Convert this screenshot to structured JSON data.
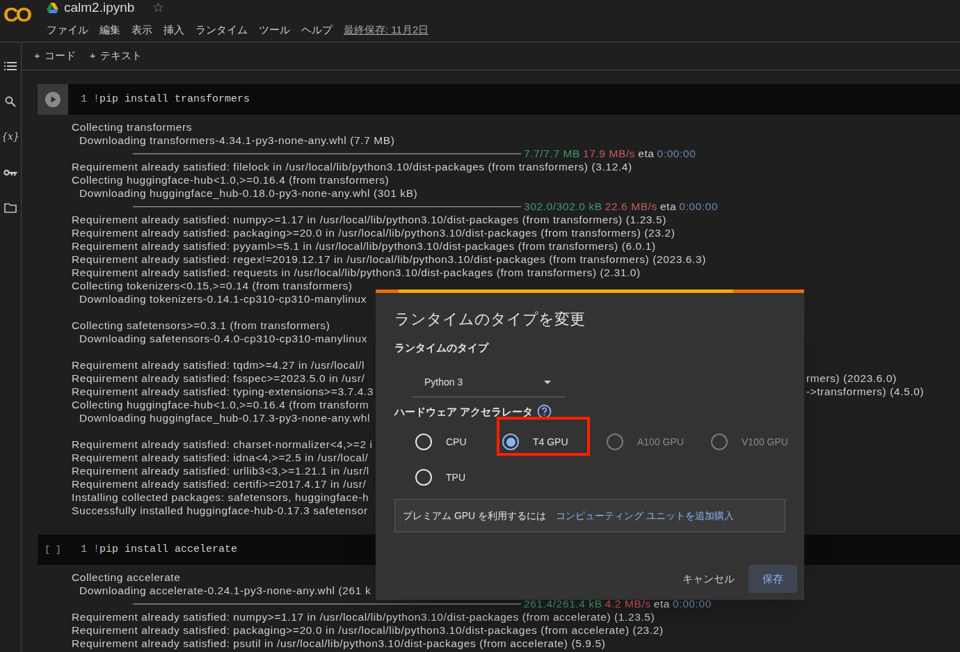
{
  "header": {
    "logo": "CO",
    "title": "calm2.ipynb",
    "star": "☆",
    "starred": false,
    "menu": [
      {
        "label": "ファイル"
      },
      {
        "label": "編集"
      },
      {
        "label": "表示"
      },
      {
        "label": "挿入"
      },
      {
        "label": "ランタイム"
      },
      {
        "label": "ツール"
      },
      {
        "label": "ヘルプ"
      }
    ],
    "last_saved": "最終保存: 11月2日"
  },
  "toolbar": [
    {
      "plus": "+",
      "label": "コード"
    },
    {
      "plus": "+",
      "label": "テキスト"
    }
  ],
  "sidebar": [
    {
      "kind": "toc"
    },
    {
      "kind": "search"
    },
    {
      "kind": "variables",
      "label": "{x}"
    },
    {
      "kind": "key"
    },
    {
      "kind": "folder"
    }
  ],
  "cells": [
    {
      "kind": "ran",
      "line_number": "1",
      "bang": "!",
      "code": "pip install transformers",
      "output": [
        {
          "kind": "text",
          "text": "Collecting transformers"
        },
        {
          "kind": "text",
          "indent": true,
          "text": "Downloading transformers-4.34.1-py3-none-any.whl (7.7 MB)"
        },
        {
          "kind": "progress",
          "level": 1,
          "done": "7.7/7.7 MB",
          "speed": "17.9 MB/s",
          "eta": "eta",
          "time": "0:00:00"
        },
        {
          "kind": "text",
          "text": "Requirement already satisfied: filelock in /usr/local/lib/python3.10/dist-packages (from transformers) (3.12.4)"
        },
        {
          "kind": "text",
          "text": "Collecting huggingface-hub<1.0,>=0.16.4 (from transformers)"
        },
        {
          "kind": "text",
          "indent": true,
          "text": "Downloading huggingface_hub-0.18.0-py3-none-any.whl (301 kB)"
        },
        {
          "kind": "progress",
          "level": 1,
          "done": "302.0/302.0 kB",
          "speed": "22.6 MB/s",
          "eta": "eta",
          "time": "0:00:00"
        },
        {
          "kind": "text",
          "text": "Requirement already satisfied: numpy>=1.17 in /usr/local/lib/python3.10/dist-packages (from transformers) (1.23.5)"
        },
        {
          "kind": "text",
          "text": "Requirement already satisfied: packaging>=20.0 in /usr/local/lib/python3.10/dist-packages (from transformers) (23.2)"
        },
        {
          "kind": "text",
          "text": "Requirement already satisfied: pyyaml>=5.1 in /usr/local/lib/python3.10/dist-packages (from transformers) (6.0.1)"
        },
        {
          "kind": "text",
          "text": "Requirement already satisfied: regex!=2019.12.17 in /usr/local/lib/python3.10/dist-packages (from transformers) (2023.6.3)"
        },
        {
          "kind": "text",
          "text": "Requirement already satisfied: requests in /usr/local/lib/python3.10/dist-packages (from transformers) (2.31.0)"
        },
        {
          "kind": "text",
          "text": "Collecting tokenizers<0.15,>=0.14 (from transformers)"
        },
        {
          "kind": "text",
          "indent": true,
          "text": "Downloading tokenizers-0.14.1-cp310-cp310-manylinux"
        },
        {
          "kind": "blank"
        },
        {
          "kind": "text",
          "text": "Collecting safetensors>=0.3.1 (from transformers)"
        },
        {
          "kind": "text",
          "indent": true,
          "text": "Downloading safetensors-0.4.0-cp310-cp310-manylinux"
        },
        {
          "kind": "blank"
        },
        {
          "kind": "text",
          "text": "Requirement already satisfied: tqdm>=4.27 in /usr/local/l"
        },
        {
          "kind": "text",
          "text": "Requirement already satisfied: fsspec>=2023.5.0 in /usr/",
          "tail": "rmers) (2023.6.0)"
        },
        {
          "kind": "text",
          "text": "Requirement already satisfied: typing-extensions>=3.7.4.3",
          "tail": "->transformers) (4.5.0)"
        },
        {
          "kind": "text",
          "text": "Collecting huggingface-hub<1.0,>=0.16.4 (from transform"
        },
        {
          "kind": "text",
          "indent": true,
          "text": "Downloading huggingface_hub-0.17.3-py3-none-any.whl"
        },
        {
          "kind": "blank"
        },
        {
          "kind": "text",
          "text": "Requirement already satisfied: charset-normalizer<4,>=2 i"
        },
        {
          "kind": "text",
          "text": "Requirement already satisfied: idna<4,>=2.5 in /usr/local/"
        },
        {
          "kind": "text",
          "text": "Requirement already satisfied: urllib3<3,>=1.21.1 in /usr/l"
        },
        {
          "kind": "text",
          "text": "Requirement already satisfied: certifi>=2017.4.17 in /usr/"
        },
        {
          "kind": "text",
          "text": "Installing collected packages: safetensors, huggingface-h"
        },
        {
          "kind": "text",
          "text": "Successfully installed huggingface-hub-0.17.3 safetensor"
        }
      ]
    },
    {
      "kind": "idle",
      "marker": "[ ]",
      "line_number": "1",
      "bang": "!",
      "code": "pip install accelerate",
      "output": [
        {
          "kind": "text",
          "text": "Collecting accelerate"
        },
        {
          "kind": "text",
          "indent": true,
          "text": "Downloading accelerate-0.24.1-py3-none-any.whl (261 k"
        },
        {
          "kind": "progress",
          "level": 1,
          "done": "261.4/261.4 kB",
          "speed": "4.2 MB/s",
          "eta": "eta",
          "time": "0:00:00"
        },
        {
          "kind": "text",
          "text": "Requirement already satisfied: numpy>=1.17 in /usr/local/lib/python3.10/dist-packages (from accelerate) (1.23.5)"
        },
        {
          "kind": "text",
          "text": "Requirement already satisfied: packaging>=20.0 in /usr/local/lib/python3.10/dist-packages (from accelerate) (23.2)"
        },
        {
          "kind": "text",
          "text": "Requirement already satisfied: psutil in /usr/local/lib/python3.10/dist-packages (from accelerate) (5.9.5)"
        }
      ]
    }
  ],
  "dialog": {
    "title": "ランタイムのタイプを変更",
    "runtime_label": "ランタイムのタイプ",
    "runtime_value": "Python 3",
    "accelerator_label": "ハードウェア アクセラレータ",
    "options": [
      {
        "label": "CPU",
        "selected": false,
        "disabled": false,
        "highlighted": false
      },
      {
        "label": "T4 GPU",
        "selected": true,
        "disabled": false,
        "highlighted": true
      },
      {
        "label": "A100 GPU",
        "selected": false,
        "disabled": true,
        "highlighted": false
      },
      {
        "label": "V100 GPU",
        "selected": false,
        "disabled": true,
        "highlighted": false
      },
      {
        "label": "TPU",
        "selected": false,
        "disabled": false,
        "highlighted": false
      }
    ],
    "info_text": "プレミアム GPU を利用するには",
    "info_link": "コンピューティング ユニットを追加購入",
    "cancel": "キャンセル",
    "save": "保存"
  }
}
